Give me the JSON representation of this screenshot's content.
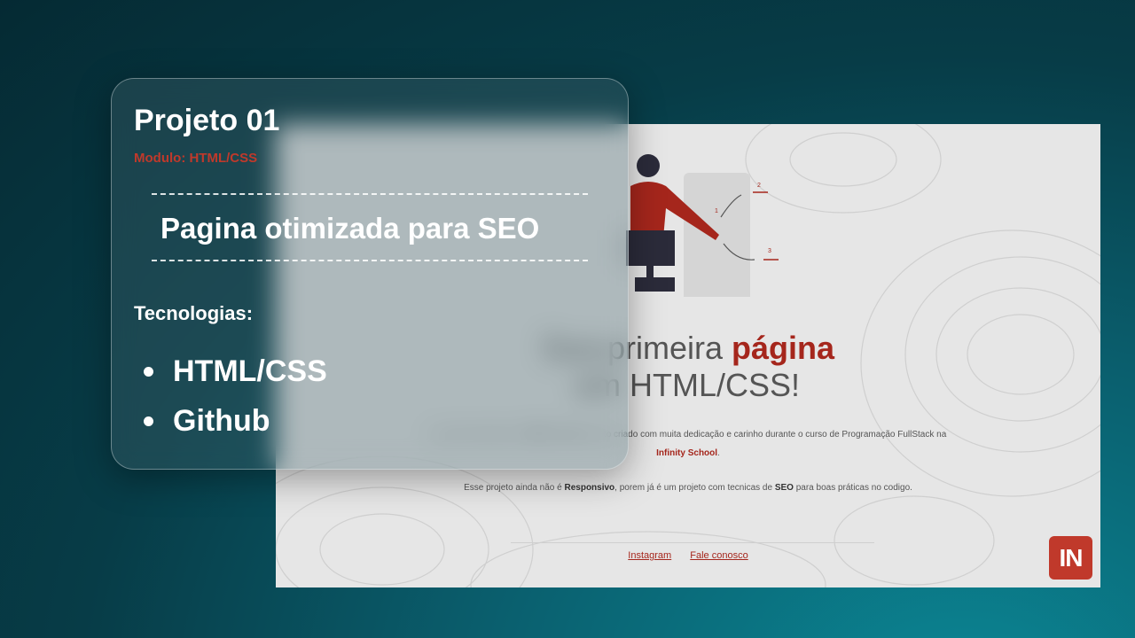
{
  "card": {
    "title": "Projeto 01",
    "module": "Modulo: HTML/CSS",
    "feature": "Pagina otimizada para SEO",
    "tech_label": "Tecnologias:",
    "tech_items": [
      "HTML/CSS",
      "Github"
    ]
  },
  "preview": {
    "hero_part1": "Sua primeira ",
    "hero_accent": "página",
    "hero_part2": " em HTML/CSS!",
    "para1_a": "Sua primeira página em ",
    "para1_html": "HTML",
    "para1_e": " e ",
    "para1_css": "CSS",
    "para1_b": ", projeto criado com muita dedicação e carinho durante o curso de Programação FullStack na ",
    "para1_school": "Infinity School",
    "para1_end": ".",
    "para2_a": "Esse projeto ainda não é ",
    "para2_resp": "Responsivo",
    "para2_b": ", porem já é um projeto com tecnicas de ",
    "para2_seo": "SEO",
    "para2_c": " para boas práticas no codigo.",
    "link_instagram": "Instagram",
    "link_contact": "Fale conosco",
    "logo_text": "IN",
    "illustration_steps": [
      "1",
      "2",
      "3"
    ]
  },
  "colors": {
    "accent_red": "#c0392b",
    "background_teal": "#0a5f6e"
  }
}
